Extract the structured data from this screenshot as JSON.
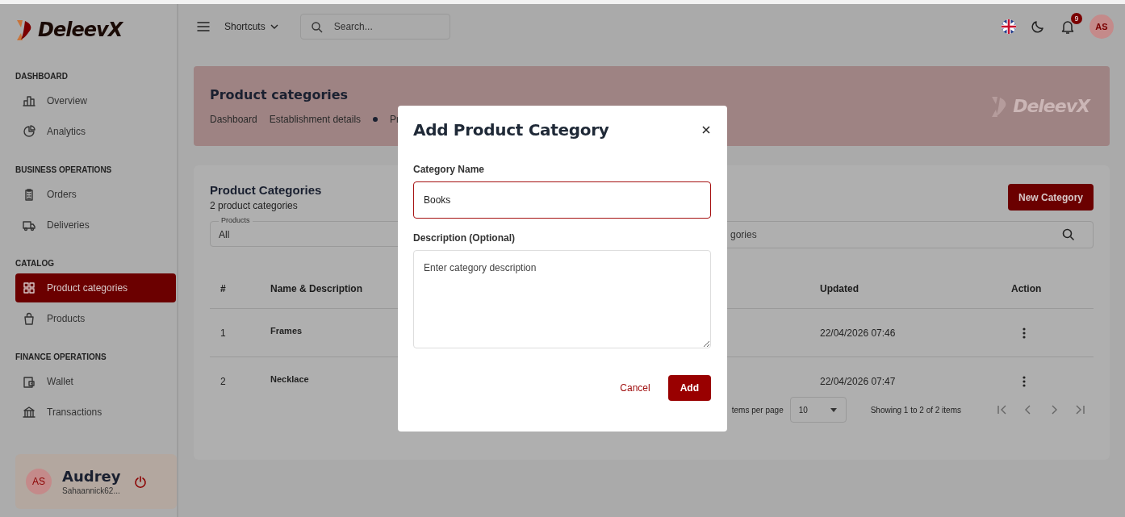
{
  "sidebar": {
    "logo": "DeleevX",
    "sections": [
      {
        "title": "DASHBOARD",
        "items": [
          {
            "label": "Overview",
            "selected": false
          },
          {
            "label": "Analytics",
            "selected": false
          }
        ]
      },
      {
        "title": "BUSINESS OPERATIONS",
        "items": [
          {
            "label": "Orders",
            "selected": false
          },
          {
            "label": "Deliveries",
            "selected": false
          }
        ]
      },
      {
        "title": "CATALOG",
        "items": [
          {
            "label": "Product categories",
            "selected": true
          },
          {
            "label": "Products",
            "selected": false
          }
        ]
      },
      {
        "title": "FINANCE OPERATIONS",
        "items": [
          {
            "label": "Wallet",
            "selected": false
          },
          {
            "label": "Transactions",
            "selected": false
          }
        ]
      }
    ],
    "user": {
      "initials": "AS",
      "name": "Audrey",
      "email": "Sahaannick62..."
    }
  },
  "topbar": {
    "shortcuts": "Shortcuts",
    "search_placeholder": "Search...",
    "notification_count": "9",
    "avatar": "AS"
  },
  "page_header": {
    "title": "Product categories",
    "breadcrumbs": [
      "Dashboard",
      "Establishment details",
      "Pr"
    ],
    "watermark": "DeleevX"
  },
  "card": {
    "title": "Product Categories",
    "subtitle": "2 product categories",
    "new_button": "New Category",
    "filter": {
      "label": "Products",
      "value": "All"
    },
    "search": {
      "placeholder": "gories"
    },
    "table": {
      "columns": [
        "#",
        "Name & Description",
        "Updated",
        "Action"
      ],
      "rows": [
        {
          "index": "1",
          "name": "Frames",
          "updated": "22/04/2026 07:46"
        },
        {
          "index": "2",
          "name": "Necklace",
          "updated": "22/04/2026 07:47"
        }
      ]
    },
    "pagination": {
      "per_page_label": "tems per page",
      "per_page": "10",
      "summary": "Showing 1 to 2 of 2 items"
    }
  },
  "modal": {
    "title": "Add Product Category",
    "name_field": {
      "label": "Category Name",
      "value": "Books",
      "focused": true
    },
    "description_field": {
      "label": "Description (Optional)",
      "placeholder": "Enter category description"
    },
    "cancel": "Cancel",
    "submit": "Add"
  }
}
